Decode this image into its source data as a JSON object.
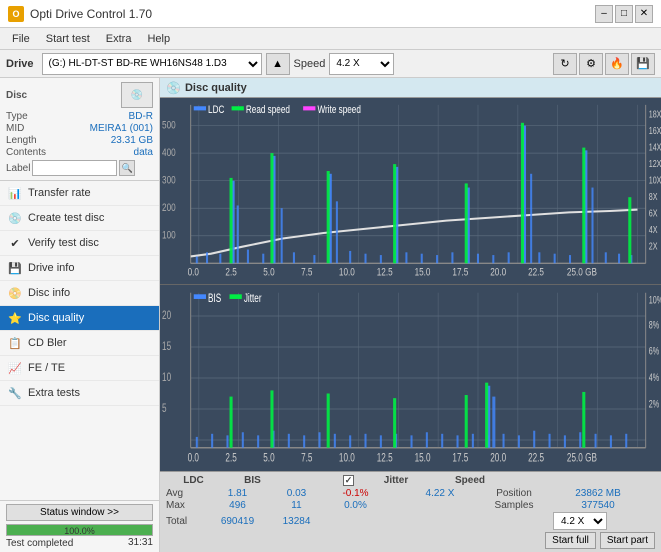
{
  "titlebar": {
    "title": "Opti Drive Control 1.70",
    "icon_label": "O",
    "minimize": "–",
    "maximize": "□",
    "close": "✕"
  },
  "menu": {
    "items": [
      "File",
      "Start test",
      "Extra",
      "Help"
    ]
  },
  "toolbar": {
    "drive_label": "Drive",
    "drive_value": "(G:) HL-DT-ST BD-RE  WH16NS48 1.D3",
    "speed_label": "Speed",
    "speed_value": "4.2 X"
  },
  "disc": {
    "type_label": "Type",
    "type_value": "BD-R",
    "mid_label": "MID",
    "mid_value": "MEIRA1 (001)",
    "length_label": "Length",
    "length_value": "23.31 GB",
    "contents_label": "Contents",
    "contents_value": "data",
    "label_label": "Label"
  },
  "nav": {
    "items": [
      {
        "id": "transfer-rate",
        "label": "Transfer rate",
        "icon": "📊"
      },
      {
        "id": "create-test-disc",
        "label": "Create test disc",
        "icon": "💿"
      },
      {
        "id": "verify-test-disc",
        "label": "Verify test disc",
        "icon": "✔"
      },
      {
        "id": "drive-info",
        "label": "Drive info",
        "icon": "💾"
      },
      {
        "id": "disc-info",
        "label": "Disc info",
        "icon": "📀"
      },
      {
        "id": "disc-quality",
        "label": "Disc quality",
        "icon": "⭐",
        "active": true
      },
      {
        "id": "cd-bler",
        "label": "CD Bler",
        "icon": "📋"
      },
      {
        "id": "fe-te",
        "label": "FE / TE",
        "icon": "📈"
      },
      {
        "id": "extra-tests",
        "label": "Extra tests",
        "icon": "🔧"
      }
    ]
  },
  "status": {
    "window_btn": "Status window >>",
    "progress": 100,
    "progress_text": "100.0%",
    "status_text": "Test completed",
    "time": "31:31"
  },
  "disc_quality": {
    "title": "Disc quality",
    "top_chart": {
      "legend": [
        {
          "label": "LDC",
          "color": "#4466ff"
        },
        {
          "label": "Read speed",
          "color": "#00ff00"
        },
        {
          "label": "Write speed",
          "color": "#ff44ff"
        }
      ],
      "y_left_max": 500,
      "y_right_labels": [
        "18X",
        "16X",
        "14X",
        "12X",
        "10X",
        "8X",
        "6X",
        "4X",
        "2X"
      ]
    },
    "bottom_chart": {
      "legend": [
        {
          "label": "BIS",
          "color": "#4466ff"
        },
        {
          "label": "Jitter",
          "color": "#00ff00"
        }
      ],
      "y_right_labels": [
        "10%",
        "8%",
        "6%",
        "4%",
        "2%"
      ]
    },
    "stats": {
      "headers": [
        "LDC",
        "BIS",
        "",
        "Jitter",
        "Speed",
        ""
      ],
      "avg_label": "Avg",
      "avg_ldc": "1.81",
      "avg_bis": "0.03",
      "avg_jitter": "-0.1%",
      "max_label": "Max",
      "max_ldc": "496",
      "max_bis": "11",
      "max_jitter": "0.0%",
      "total_label": "Total",
      "total_ldc": "690419",
      "total_bis": "13284",
      "position_label": "Position",
      "position_value": "23862 MB",
      "samples_label": "Samples",
      "samples_value": "377540",
      "speed_value": "4.22 X",
      "speed_dropdown": "4.2 X",
      "start_full": "Start full",
      "start_part": "Start part"
    }
  }
}
